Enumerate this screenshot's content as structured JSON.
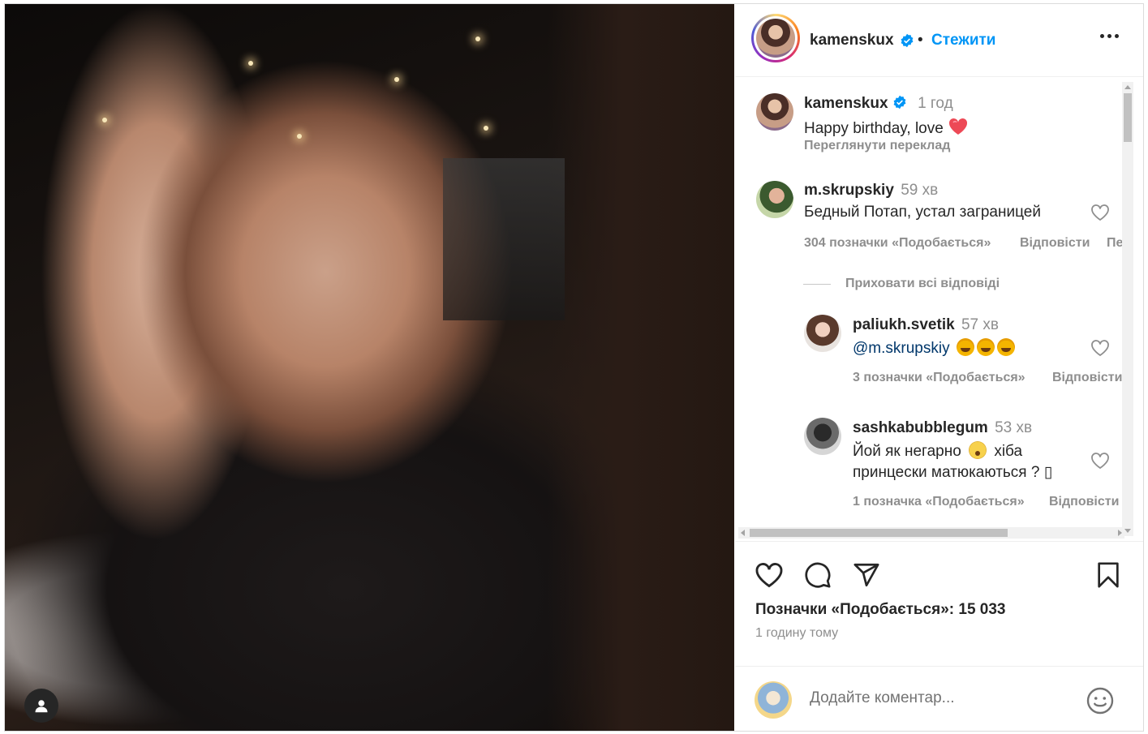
{
  "photo": {
    "alt": ""
  },
  "header": {
    "username": "kamenskux",
    "separator": "•",
    "follow_label": "Стежити"
  },
  "caption": {
    "username": "kamenskux",
    "time": "1 год",
    "text": "Happy birthday, love",
    "translate_label": "Переглянути переклад"
  },
  "comments": [
    {
      "username": "m.skrupskiy",
      "time": "59 хв",
      "text": "Бедный Потап, устал заграницей",
      "likes": "304 позначки «Подобається»",
      "reply_label": "Відповісти",
      "more_label": "Пер",
      "hide_replies_label": "Приховати всі відповіді"
    }
  ],
  "replies": [
    {
      "username": "paliukh.svetik",
      "time": "57 хв",
      "mention": "@m.skrupskiy",
      "likes": "3 позначки «Подобається»",
      "reply_label": "Відповісти"
    },
    {
      "username": "sashkabubblegum",
      "time": "53 хв",
      "text_line1_a": "Йой як негарно",
      "text_line1_b": "хіба",
      "text_line2": "принцески матюкаються ? ▯",
      "likes": "1 позначка «Подобається»",
      "reply_label": "Відповісти"
    }
  ],
  "actions": {
    "likes_label": "Позначки «Подобається»: 15 033",
    "time_ago": "1 годину тому"
  },
  "add_comment": {
    "placeholder": "Додайте коментар..."
  },
  "colors": {
    "accent": "#0095f6",
    "text": "#262626",
    "secondary": "#8e8e8e",
    "heart_red": "#ed4956"
  }
}
